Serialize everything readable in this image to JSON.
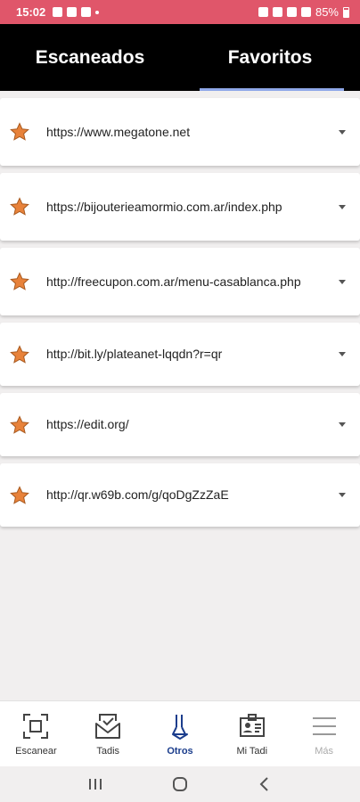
{
  "status_bar": {
    "time": "15:02",
    "battery": "85%"
  },
  "tabs": [
    {
      "label": "Escaneados",
      "active": false
    },
    {
      "label": "Favoritos",
      "active": true
    }
  ],
  "favorites": [
    {
      "url": "https://www.megatone.net"
    },
    {
      "url": "https://bijouterieamormio.com.ar/index.php"
    },
    {
      "url": "http://freecupon.com.ar/menu-casablanca.php"
    },
    {
      "url": "http://bit.ly/plateanet-lqqdn?r=qr"
    },
    {
      "url": "https://edit.org/"
    },
    {
      "url": "http://qr.w69b.com/g/qoDgZzZaE"
    }
  ],
  "bottom_nav": [
    {
      "label": "Escanear",
      "icon": "scan-icon"
    },
    {
      "label": "Tadis",
      "icon": "envelope-check-icon"
    },
    {
      "label": "Otros",
      "icon": "otros-icon",
      "active": true
    },
    {
      "label": "Mi Tadi",
      "icon": "id-badge-icon"
    },
    {
      "label": "Más",
      "icon": "menu-icon",
      "disabled": true
    }
  ],
  "colors": {
    "status_bar": "#e0566a",
    "header": "#000000",
    "tab_underline": "#8fa8e8",
    "star": "#e8823a",
    "active_nav": "#1b3d8c"
  }
}
